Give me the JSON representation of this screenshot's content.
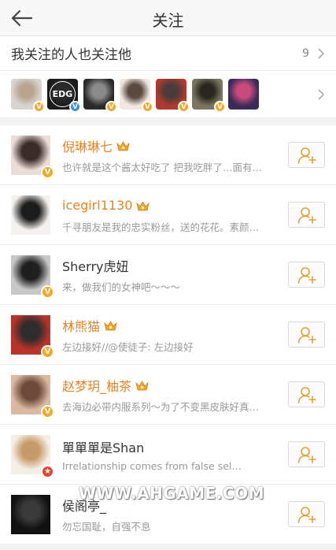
{
  "header": {
    "title": "关注",
    "back_icon": "arrow-left-icon"
  },
  "mutual": {
    "title": "我关注的人也关注他",
    "count": "9"
  },
  "mutual_avatars": [
    {
      "badge": "V",
      "badge_color": "#f5a623",
      "colors": [
        "#d8d4cf",
        "#b9a58e"
      ]
    },
    {
      "badge": "V",
      "badge_color": "#3a8ee6",
      "colors": [
        "#1a1a1a",
        "#2b2b2b"
      ],
      "logo": "EDG"
    },
    {
      "badge": "V",
      "badge_color": "#f5a623",
      "colors": [
        "#2a2a2a",
        "#8a8a8a"
      ]
    },
    {
      "badge": "V",
      "badge_color": "#f5a623",
      "colors": [
        "#f1e7e1",
        "#5b4a3f"
      ]
    },
    {
      "badge": "V",
      "badge_color": "#f5a623",
      "colors": [
        "#b03a2e",
        "#4a3c3a"
      ]
    },
    {
      "badge": "V",
      "badge_color": "#f5a623",
      "colors": [
        "#7a7560",
        "#2a2620"
      ]
    },
    {
      "badge": "",
      "badge_color": "",
      "colors": [
        "#3b2b5a",
        "#c94a7a"
      ]
    }
  ],
  "users": [
    {
      "name": "倪琳琳七",
      "vip": true,
      "desc": "也许就是这个酱太好吃了 把我吃胖了…面有…",
      "badge": "V",
      "badge_color": "#f5a623",
      "colors": [
        "#e9ddd6",
        "#3a2a2a"
      ]
    },
    {
      "name": "icegirl1130",
      "vip": true,
      "desc": "千寻朋友是我的忠实粉丝，送的花花。素颜…",
      "badge": "",
      "badge_color": "",
      "colors": [
        "#f4f1ef",
        "#1c1c1c"
      ]
    },
    {
      "name": "Sherry虎妞",
      "vip": false,
      "desc": "来，做我们的女神吧～～～",
      "badge": "V",
      "badge_color": "#f5a623",
      "colors": [
        "#c7c7c7",
        "#1f1f1f"
      ]
    },
    {
      "name": "林熊猫",
      "vip": true,
      "desc": "左边接好//@使徒子: 左边接好",
      "badge": "V",
      "badge_color": "#f5a623",
      "colors": [
        "#b8342a",
        "#2d2d2d"
      ]
    },
    {
      "name": "赵梦玥_柚茶",
      "vip": true,
      "desc": "去海边必带内服系列～为了不变黑皮肤好真…",
      "badge": "V",
      "badge_color": "#f5a623",
      "colors": [
        "#d9b9a2",
        "#6b4a3a"
      ]
    },
    {
      "name": "單單單是Shan",
      "vip": false,
      "desc": "Irrelationship comes from false sel…",
      "badge": "★",
      "badge_color": "#e0462f",
      "colors": [
        "#f4efe6",
        "#c79a6a"
      ]
    },
    {
      "name": "侯阁亭_",
      "vip": false,
      "desc": "勿忘国耻，自强不息",
      "badge": "",
      "badge_color": "",
      "colors": [
        "#111111",
        "#3a3a3a"
      ]
    }
  ],
  "watermark": "WWW.AHGAME.COM"
}
